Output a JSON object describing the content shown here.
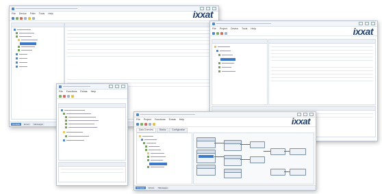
{
  "brand": "ixxat",
  "colors": {
    "accent": "#3b78c8",
    "brand": "#1d3f6e"
  },
  "win1": {
    "menu": [
      "File",
      "Device",
      "Filter",
      "Tools",
      "Help"
    ],
    "status_tabs": [
      "Console",
      "Errors",
      "Messages"
    ]
  },
  "win2": {
    "menu": [
      "File",
      "Project",
      "Device",
      "Tools",
      "Help"
    ]
  },
  "win3": {
    "menu": [
      "File",
      "Functions",
      "Extras",
      "Help"
    ]
  },
  "win4": {
    "menu": [
      "File",
      "Project",
      "Functions",
      "Extras",
      "Help"
    ],
    "tabs": [
      "Data Overview",
      "Blocks",
      "Configuration"
    ],
    "status_tabs": [
      "Console",
      "Errors",
      "Messages"
    ]
  }
}
